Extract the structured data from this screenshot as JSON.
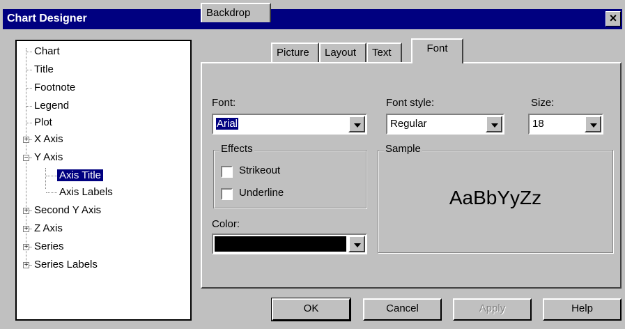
{
  "window": {
    "title": "Chart Designer",
    "close_glyph": "×"
  },
  "tree": {
    "items": [
      {
        "label": "Chart"
      },
      {
        "label": "Title"
      },
      {
        "label": "Footnote"
      },
      {
        "label": "Legend"
      },
      {
        "label": "Plot"
      },
      {
        "label": "X Axis",
        "expander": "+"
      },
      {
        "label": "Y Axis",
        "expander": "−"
      },
      {
        "label": "Axis Title",
        "selected": true
      },
      {
        "label": "Axis Labels"
      },
      {
        "label": "Second Y Axis",
        "expander": "+"
      },
      {
        "label": "Z Axis",
        "expander": "+"
      },
      {
        "label": "Series",
        "expander": "+"
      },
      {
        "label": "Series Labels",
        "expander": "+"
      }
    ]
  },
  "tabs": [
    "Backdrop",
    "Picture",
    "Layout",
    "Text",
    "Font"
  ],
  "active_tab": "Font",
  "font_tab": {
    "font_label": "Font:",
    "font_value": "Arial",
    "font_style_label": "Font style:",
    "font_style_value": "Regular",
    "size_label": "Size:",
    "size_value": "18",
    "effects_label": "Effects",
    "strikeout_label": "Strikeout",
    "underline_label": "Underline",
    "color_label": "Color:",
    "color_value": "#000000",
    "sample_label": "Sample",
    "sample_text": "AaBbYyZz"
  },
  "buttons": {
    "ok": "OK",
    "cancel": "Cancel",
    "apply": "Apply",
    "help": "Help"
  },
  "colors": {
    "titlebar": "#000080",
    "face": "#c0c0c0",
    "selection": "#000080"
  }
}
